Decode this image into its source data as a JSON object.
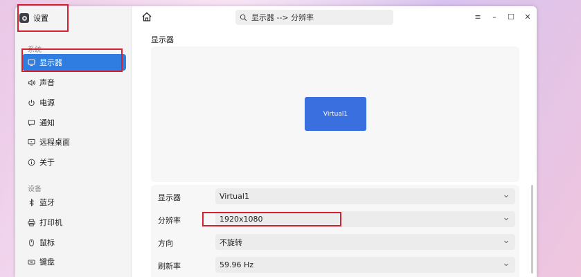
{
  "app": {
    "title": "设置"
  },
  "sidebar": {
    "groups": [
      {
        "label": "系统"
      },
      {
        "label": "设备"
      }
    ],
    "items": [
      {
        "label": "显示器",
        "icon": "monitor-icon",
        "active": true
      },
      {
        "label": "声音",
        "icon": "speaker-icon"
      },
      {
        "label": "电源",
        "icon": "power-icon"
      },
      {
        "label": "通知",
        "icon": "notification-icon"
      },
      {
        "label": "远程桌面",
        "icon": "remote-desktop-icon"
      },
      {
        "label": "关于",
        "icon": "info-icon"
      },
      {
        "label": "蓝牙",
        "icon": "bluetooth-icon"
      },
      {
        "label": "打印机",
        "icon": "printer-icon"
      },
      {
        "label": "鼠标",
        "icon": "mouse-icon"
      },
      {
        "label": "键盘",
        "icon": "keyboard-icon"
      }
    ]
  },
  "header": {
    "breadcrumb": "显示器 --> 分辨率",
    "window_controls": [
      "menu-icon",
      "minimize-icon",
      "maximize-icon",
      "close-icon"
    ]
  },
  "main": {
    "section_title": "显示器",
    "monitor_label": "Virtual1",
    "settings": [
      {
        "label": "显示器",
        "value": "Virtual1"
      },
      {
        "label": "分辨率",
        "value": "1920x1080"
      },
      {
        "label": "方向",
        "value": "不旋转"
      },
      {
        "label": "刷新率",
        "value": "59.96 Hz"
      }
    ]
  },
  "colors": {
    "accent": "#2f7de1",
    "monitor_fill": "#3a6fe0",
    "highlight_box": "#d2222f"
  }
}
